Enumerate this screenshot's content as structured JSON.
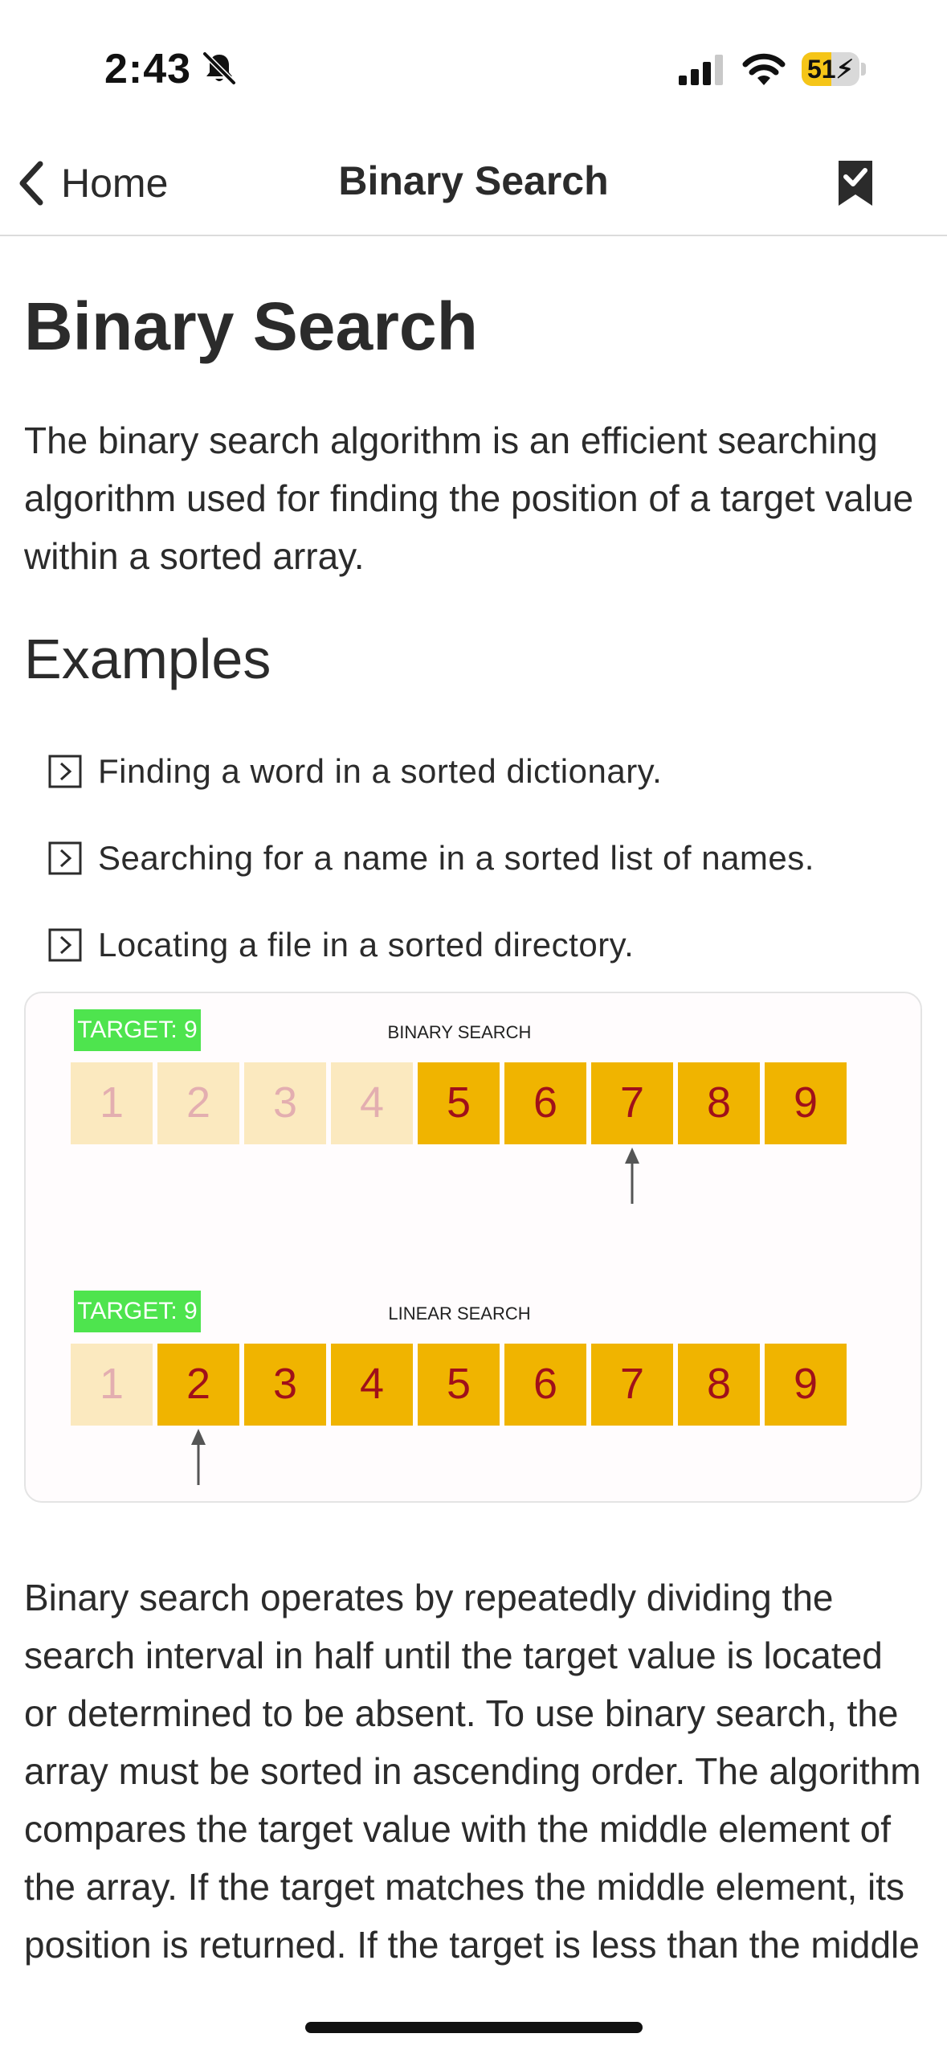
{
  "status_bar": {
    "time": "2:43",
    "battery_level": "51",
    "battery_percent": 51,
    "battery_color": "#f5c518"
  },
  "nav": {
    "back_label": "Home",
    "title": "Binary Search",
    "back_icon": "chevron-left-icon",
    "bookmark_icon": "bookmark-check-icon"
  },
  "article": {
    "title": "Binary Search",
    "intro": "The binary search algorithm is an efficient searching algorithm used for finding the position of a target value within a sorted array.",
    "examples_heading": "Examples",
    "examples": [
      "Finding a word in a sorted dictionary.",
      "Searching for a name in a sorted list of names.",
      "Locating a file in a sorted directory."
    ],
    "body": "Binary search operates by repeatedly dividing the search interval in half until the target value is located or determined to be absent. To use binary search, the array must be sorted in ascending order. The algorithm compares the target value with the middle element of the array. If the target matches the middle element, its position is returned. If the target is less than the middle"
  },
  "figure": {
    "colors": {
      "target_badge": "#4ee44e",
      "cell_active": "#f0b400",
      "cell_faded": "#fbe9bf",
      "digit_active": "#a0101a",
      "digit_faded": "#e3aeb0",
      "arrow": "#555555"
    },
    "panels": [
      {
        "target_label": "TARGET: 9",
        "title": "BINARY SEARCH",
        "cells": [
          "1",
          "2",
          "3",
          "4",
          "5",
          "6",
          "7",
          "8",
          "9"
        ],
        "faded_count": 4,
        "pointer_index": 6
      },
      {
        "target_label": "TARGET: 9",
        "title": "LINEAR SEARCH",
        "cells": [
          "1",
          "2",
          "3",
          "4",
          "5",
          "6",
          "7",
          "8",
          "9"
        ],
        "faded_count": 1,
        "pointer_index": 1
      }
    ]
  }
}
